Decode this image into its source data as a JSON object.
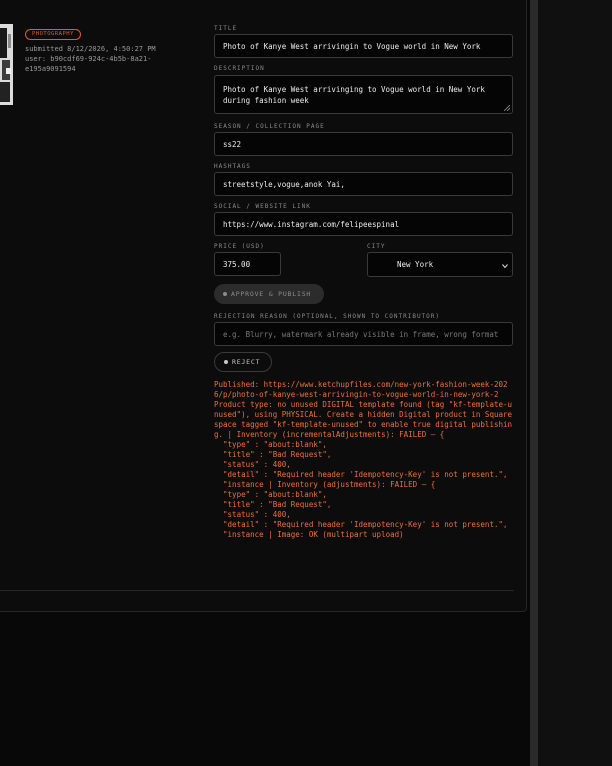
{
  "submission": {
    "category_badge": "PHOTOGRAPHY",
    "submitted": "submitted 8/12/2026, 4:50:27 PM",
    "user": "user: b90cdf69-924c-4b5b-8a21-e195a9091594"
  },
  "form": {
    "title": {
      "label": "TITLE",
      "value": "Photo of Kanye West arrivingin to Vogue world in New York"
    },
    "description": {
      "label": "DESCRIPTION",
      "value": "Photo of Kanye West arrivinging to Vogue world in New York during fashion week"
    },
    "season": {
      "label": "SEASON / COLLECTION PAGE",
      "value": "ss22"
    },
    "hashtags": {
      "label": "HASHTAGS",
      "value": "streetstyle,vogue,anok Yai,"
    },
    "social": {
      "label": "SOCIAL / WEBSITE LINK",
      "value": "https://www.instagram.com/felipeespinal"
    },
    "price": {
      "label": "PRICE (USD)",
      "value": "375.00"
    },
    "city": {
      "label": "CITY",
      "value": "New York"
    },
    "approve_label": "APPROVE & PUBLISH",
    "rejection": {
      "label": "REJECTION REASON (OPTIONAL, SHOWN TO CONTRIBUTOR)",
      "placeholder": "e.g. Blurry, watermark already visible in frame, wrong format"
    },
    "reject_label": "REJECT"
  },
  "log": {
    "text": "Published: https://www.ketchupfiles.com/new-york-fashion-week-2026/p/photo-of-kanye-west-arrivingin-to-vogue-world-in-new-york-2\nProduct type: no unused DIGITAL template found (tag \"kf-template-unused\"), using PHYSICAL. Create a hidden Digital product in Squarespace tagged \"kf-template-unused\" to enable true digital publishing. | Inventory (incrementalAdjustments): FAILED — {\n  \"type\" : \"about:blank\",\n  \"title\" : \"Bad Request\",\n  \"status\" : 400,\n  \"detail\" : \"Required header 'Idempotency-Key' is not present.\",\n  \"instance | Inventory (adjustments): FAILED — {\n  \"type\" : \"about:blank\",\n  \"title\" : \"Bad Request\",\n  \"status\" : 400,\n  \"detail\" : \"Required header 'Idempotency-Key' is not present.\",\n  \"instance | Image: OK (multipart upload)",
    "color": "#f07038"
  },
  "colors": {
    "accent": "#e05a2a",
    "background": "#0c0c0c"
  }
}
